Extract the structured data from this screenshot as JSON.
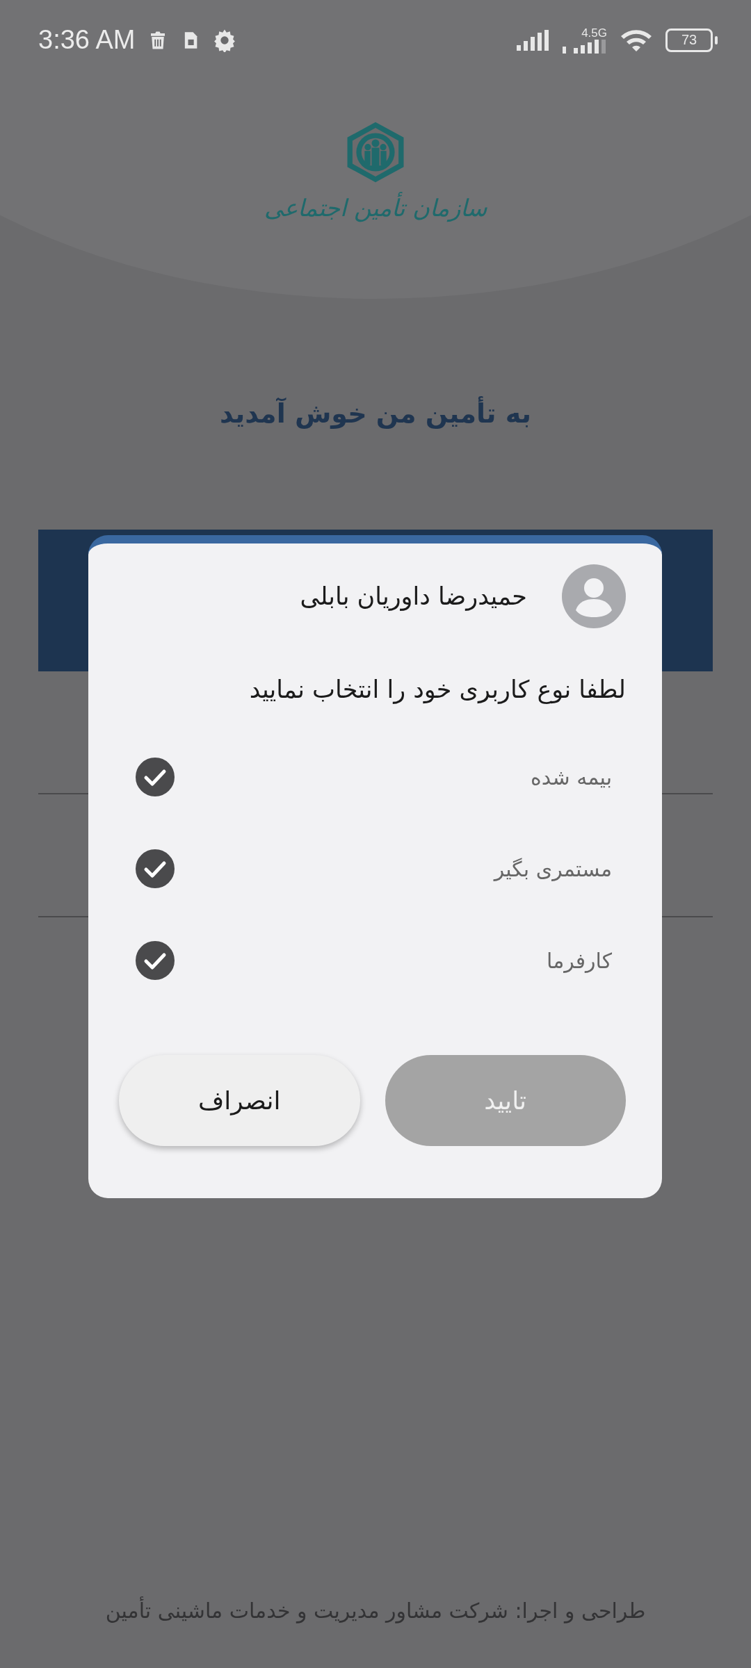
{
  "status_bar": {
    "time": "3:36 AM",
    "network": "4.5G",
    "battery": "73"
  },
  "header": {
    "logo_text": "سازمان تأمین اجتماعی"
  },
  "welcome": "به تأمین من خوش آمدید",
  "dialog": {
    "user_name": "حمیدرضا داوریان بابلی",
    "prompt": "لطفا نوع کاربری خود را انتخاب نمایید",
    "options": [
      {
        "label": "بیمه شده",
        "checked": true
      },
      {
        "label": "مستمری بگیر",
        "checked": true
      },
      {
        "label": "کارفرما",
        "checked": true
      }
    ],
    "buttons": [
      {
        "label": "تایید",
        "kind": "primary",
        "disabled": true
      },
      {
        "label": "انصراف",
        "kind": "secondary",
        "disabled": false
      }
    ]
  },
  "footer": "طراحی و اجرا: شرکت مشاور مدیریت و خدمات ماشینی تأمین"
}
